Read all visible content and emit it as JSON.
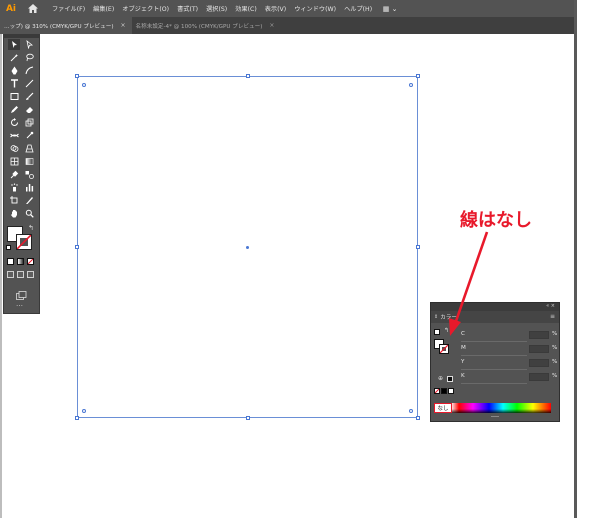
{
  "app": {
    "logo": "Ai",
    "accent": "#ff9a00"
  },
  "menu": {
    "items": [
      "ファイル(F)",
      "編集(E)",
      "オブジェクト(O)",
      "書式(T)",
      "選択(S)",
      "効果(C)",
      "表示(V)",
      "ウィンドウ(W)",
      "ヘルプ(H)"
    ],
    "workspace_icon": "▦ ⌄"
  },
  "tabs": [
    {
      "label": "…ップ) @ 310% (CMYK/GPU プレビュー)",
      "close": "×",
      "active": true
    },
    {
      "label": "名称未設定-4* @ 100% (CMYK/GPU プレビュー)",
      "close": "×",
      "active": false
    }
  ],
  "annotation": {
    "text": "線はなし",
    "color": "#e8192b"
  },
  "color_panel": {
    "title": "カラー",
    "menu_icon": "≡",
    "channels": [
      {
        "label": "C",
        "value": "",
        "unit": "%"
      },
      {
        "label": "M",
        "value": "",
        "unit": "%"
      },
      {
        "label": "Y",
        "value": "",
        "unit": "%"
      },
      {
        "label": "K",
        "value": "",
        "unit": "%"
      }
    ],
    "none_label": "なし",
    "fill": "none",
    "stroke": "none"
  },
  "toolbar": {
    "tools": [
      "selection",
      "direct-selection",
      "magic-wand",
      "lasso",
      "pen",
      "curvature",
      "type",
      "line",
      "rectangle",
      "paintbrush",
      "pencil",
      "eraser",
      "rotate",
      "scale",
      "width",
      "free-transform",
      "shape-builder",
      "perspective",
      "mesh",
      "gradient",
      "eyedropper",
      "blend",
      "symbol-sprayer",
      "column-graph",
      "artboard",
      "slice",
      "hand",
      "zoom"
    ],
    "more": "…"
  }
}
